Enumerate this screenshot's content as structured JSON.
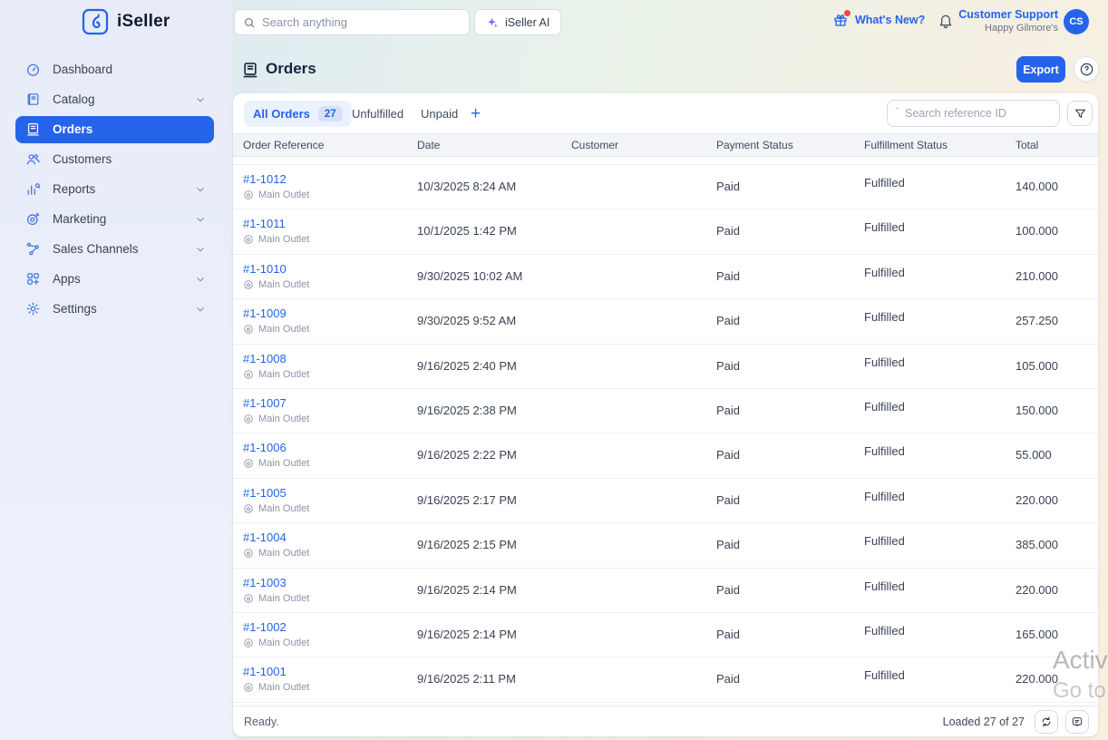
{
  "brand": {
    "name": "iSeller"
  },
  "topbar": {
    "search_placeholder": "Search anything",
    "ai_button_label": "iSeller AI",
    "whats_new_label": "What's New?",
    "account_name": "Customer Support",
    "store_name": "Happy Gilmore's",
    "avatar_initials": "CS"
  },
  "sidebar": {
    "items": [
      {
        "label": "Dashboard",
        "icon": "gauge",
        "chevron": false,
        "active": false
      },
      {
        "label": "Catalog",
        "icon": "book",
        "chevron": true,
        "active": false
      },
      {
        "label": "Orders",
        "icon": "ledger",
        "chevron": false,
        "active": true
      },
      {
        "label": "Customers",
        "icon": "users",
        "chevron": false,
        "active": false
      },
      {
        "label": "Reports",
        "icon": "chart",
        "chevron": true,
        "active": false
      },
      {
        "label": "Marketing",
        "icon": "target",
        "chevron": true,
        "active": false
      },
      {
        "label": "Sales Channels",
        "icon": "network",
        "chevron": true,
        "active": false
      },
      {
        "label": "Apps",
        "icon": "grid",
        "chevron": true,
        "active": false
      },
      {
        "label": "Settings",
        "icon": "gear",
        "chevron": true,
        "active": false
      }
    ]
  },
  "page": {
    "title": "Orders",
    "export_label": "Export",
    "tabs": [
      {
        "label": "All Orders",
        "badge": "27"
      },
      {
        "label": "Unfulfilled"
      },
      {
        "label": "Unpaid"
      }
    ],
    "add_tab_label": "+",
    "ref_search_placeholder": "Search reference ID"
  },
  "table": {
    "columns": [
      "Order Reference",
      "Date",
      "Customer",
      "Payment Status",
      "Fulfillment Status",
      "Total"
    ],
    "rows": [
      {
        "ref": "#1-1012",
        "outlet": "Main Outlet",
        "date": "10/3/2025 8:24 AM",
        "customer": "",
        "payment": "Paid",
        "fulfillment": "Fulfilled",
        "total": "140.000"
      },
      {
        "ref": "#1-1011",
        "outlet": "Main Outlet",
        "date": "10/1/2025 1:42 PM",
        "customer": "",
        "payment": "Paid",
        "fulfillment": "Fulfilled",
        "total": "100.000"
      },
      {
        "ref": "#1-1010",
        "outlet": "Main Outlet",
        "date": "9/30/2025 10:02 AM",
        "customer": "",
        "payment": "Paid",
        "fulfillment": "Fulfilled",
        "total": "210.000"
      },
      {
        "ref": "#1-1009",
        "outlet": "Main Outlet",
        "date": "9/30/2025 9:52 AM",
        "customer": "",
        "payment": "Paid",
        "fulfillment": "Fulfilled",
        "total": "257.250"
      },
      {
        "ref": "#1-1008",
        "outlet": "Main Outlet",
        "date": "9/16/2025 2:40 PM",
        "customer": "",
        "payment": "Paid",
        "fulfillment": "Fulfilled",
        "total": "105.000"
      },
      {
        "ref": "#1-1007",
        "outlet": "Main Outlet",
        "date": "9/16/2025 2:38 PM",
        "customer": "",
        "payment": "Paid",
        "fulfillment": "Fulfilled",
        "total": "150.000"
      },
      {
        "ref": "#1-1006",
        "outlet": "Main Outlet",
        "date": "9/16/2025 2:22 PM",
        "customer": "",
        "payment": "Paid",
        "fulfillment": "Fulfilled",
        "total": "55.000"
      },
      {
        "ref": "#1-1005",
        "outlet": "Main Outlet",
        "date": "9/16/2025 2:17 PM",
        "customer": "",
        "payment": "Paid",
        "fulfillment": "Fulfilled",
        "total": "220.000"
      },
      {
        "ref": "#1-1004",
        "outlet": "Main Outlet",
        "date": "9/16/2025 2:15 PM",
        "customer": "",
        "payment": "Paid",
        "fulfillment": "Fulfilled",
        "total": "385.000"
      },
      {
        "ref": "#1-1003",
        "outlet": "Main Outlet",
        "date": "9/16/2025 2:14 PM",
        "customer": "",
        "payment": "Paid",
        "fulfillment": "Fulfilled",
        "total": "220.000"
      },
      {
        "ref": "#1-1002",
        "outlet": "Main Outlet",
        "date": "9/16/2025 2:14 PM",
        "customer": "",
        "payment": "Paid",
        "fulfillment": "Fulfilled",
        "total": "165.000"
      },
      {
        "ref": "#1-1001",
        "outlet": "Main Outlet",
        "date": "9/16/2025 2:11 PM",
        "customer": "",
        "payment": "Paid",
        "fulfillment": "Fulfilled",
        "total": "220.000"
      }
    ]
  },
  "statusbar": {
    "left_text": "Ready.",
    "loaded_text": "Loaded 27 of 27"
  },
  "watermark": {
    "line1": "Activ",
    "line2": "Go to"
  },
  "colors": {
    "primary": "#2563eb",
    "link": "#2563eb",
    "sidebar_bg": "#e9edf9",
    "header_band": "#f2f4f8",
    "badge_bg": "#d6e1f6",
    "alert_dot": "#e94848"
  }
}
